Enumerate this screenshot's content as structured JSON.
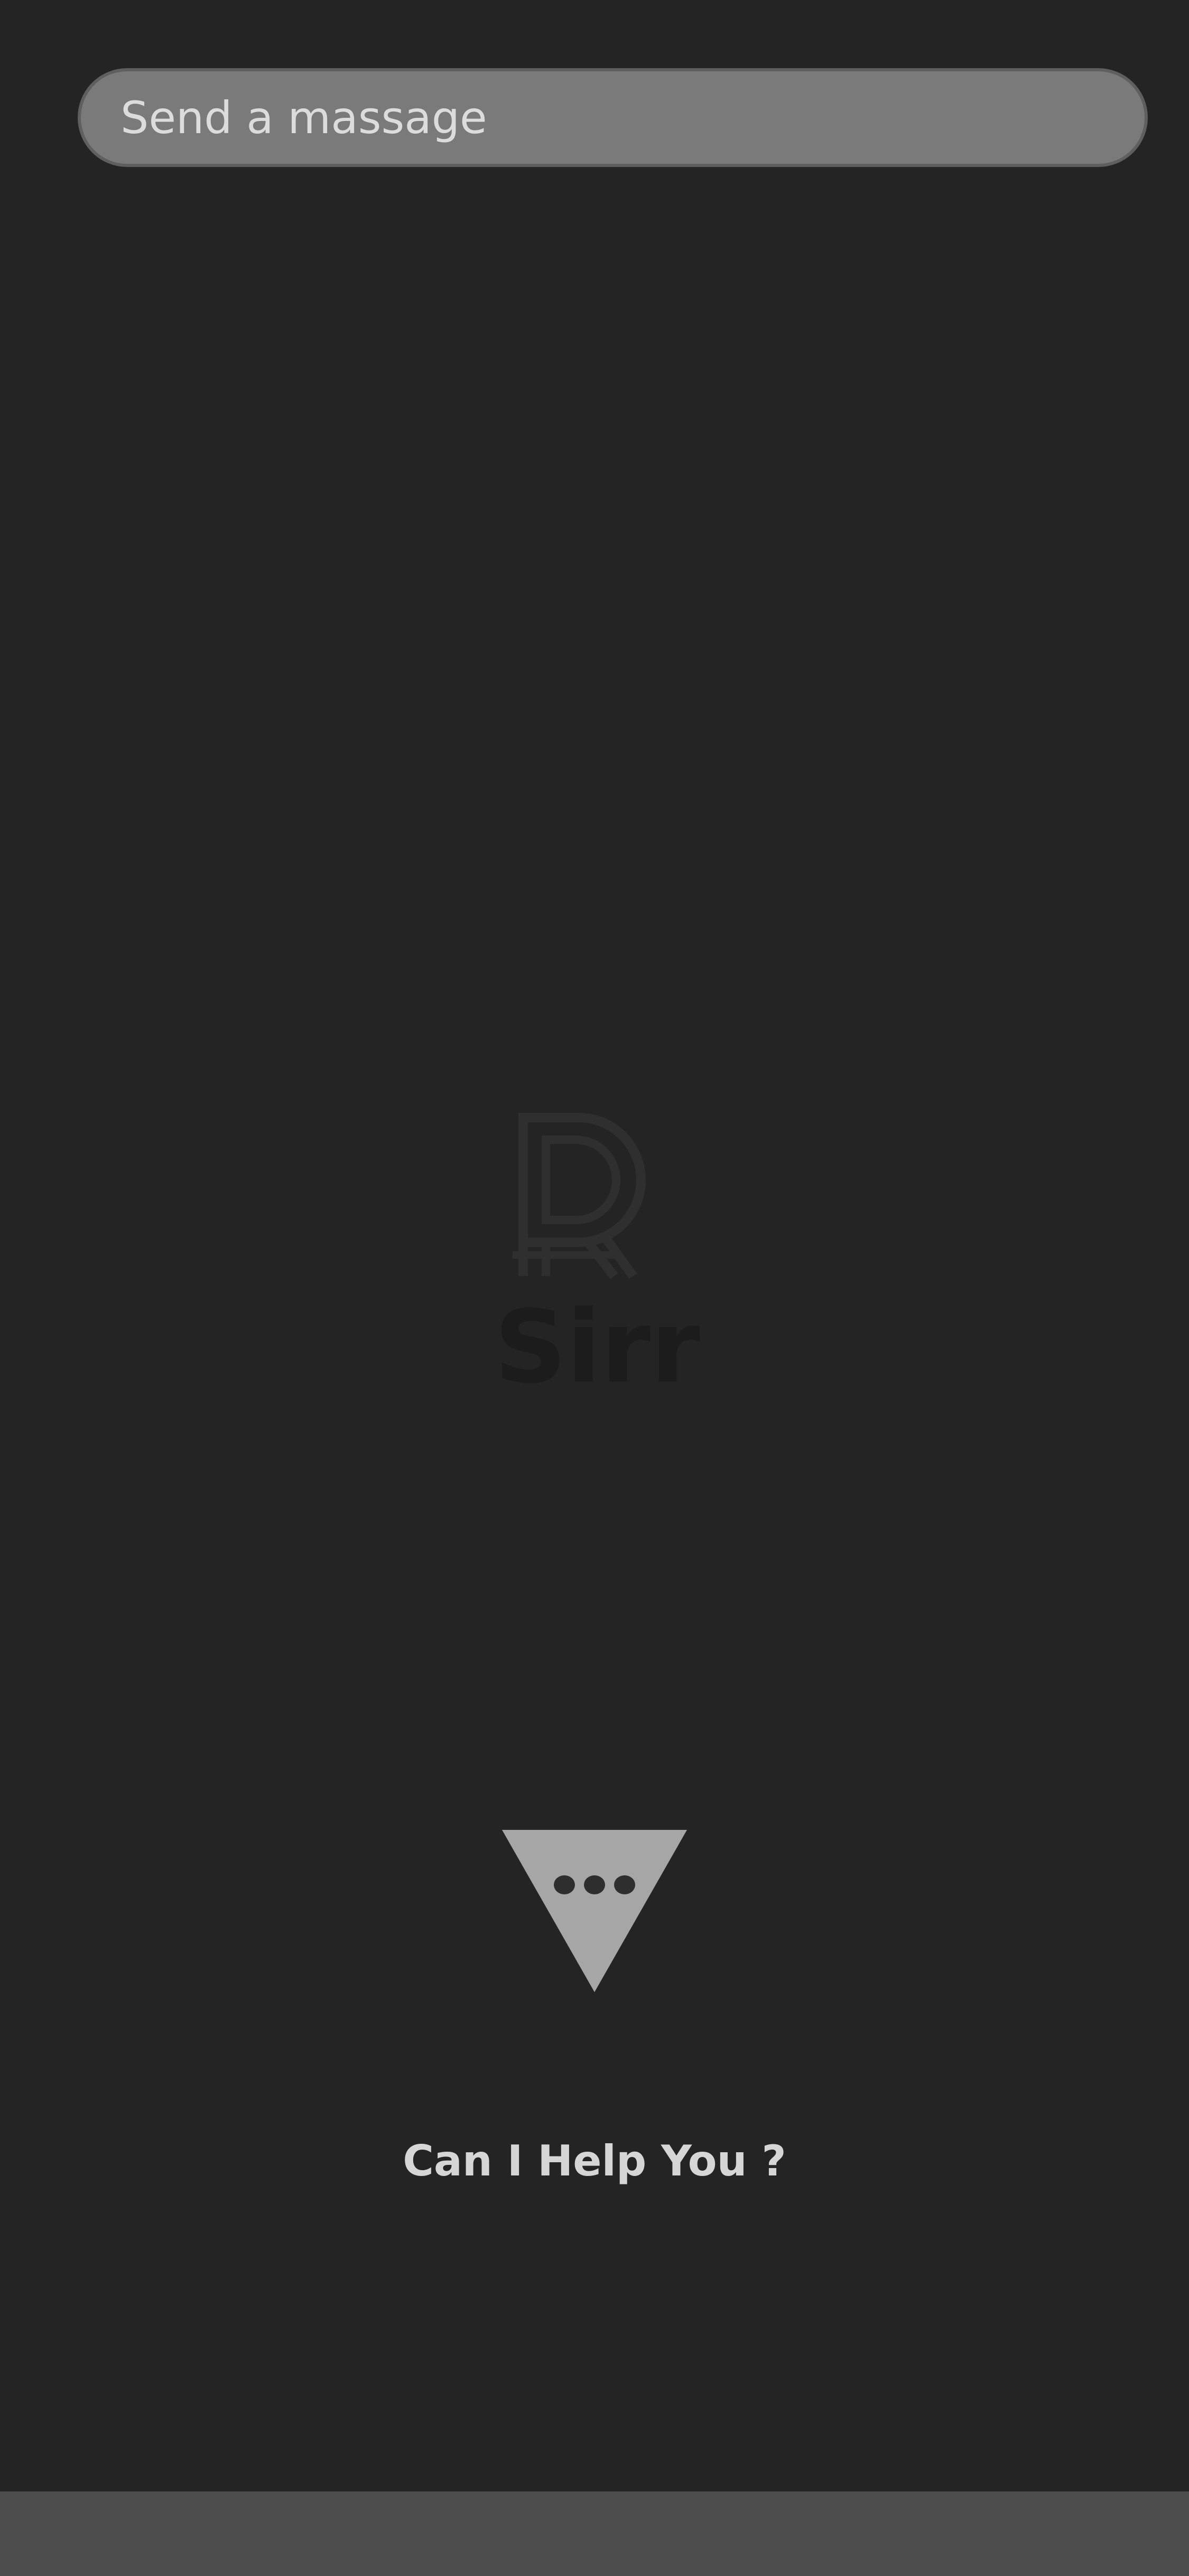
{
  "message_bar": {
    "placeholder": "Send a massage",
    "value": ""
  },
  "logo": {
    "brand_name": "Sirr",
    "icon": "sirr-logo-icon"
  },
  "assistant": {
    "icon": "typing-dots-triangle-icon",
    "prompt": "Can I Help You ?"
  },
  "colors": {
    "background": "#242424",
    "input_fill": "#7a7a7a",
    "input_border": "#5f5f5f",
    "logo_mark": "#2f2f2f",
    "triangle": "#a6a6a6",
    "help_text": "#d6d6d6",
    "bottom_bar": "#4d4d4d"
  }
}
